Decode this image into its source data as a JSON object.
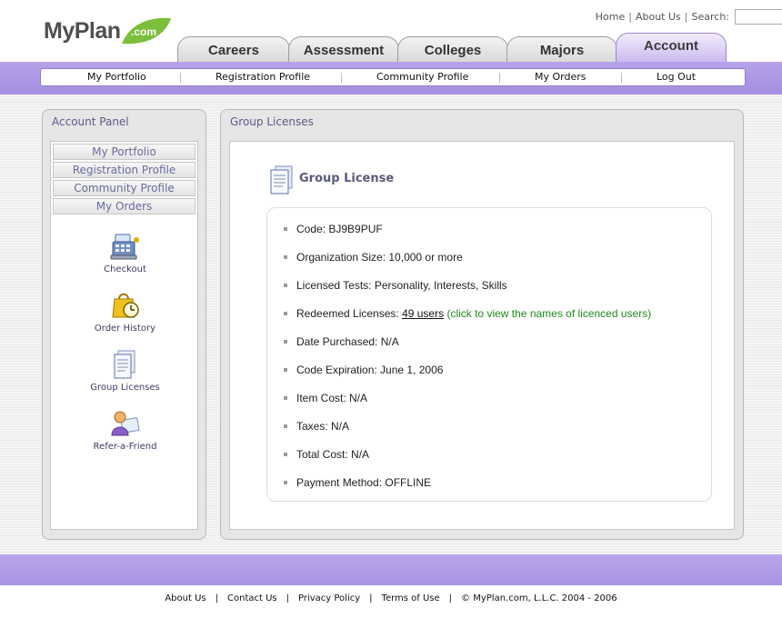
{
  "brand": {
    "name": "MyPlan",
    "suffix": ".com",
    "accent": "#7bbf3a"
  },
  "top_links": {
    "home": "Home",
    "about": "About Us",
    "search_label": "Search:"
  },
  "tabs": [
    {
      "label": "Careers"
    },
    {
      "label": "Assessment"
    },
    {
      "label": "Colleges"
    },
    {
      "label": "Majors"
    },
    {
      "label": "Account",
      "active": true
    }
  ],
  "subnav": [
    "My Portfolio",
    "Registration Profile",
    "Community Profile",
    "My Orders",
    "Log Out"
  ],
  "account_panel": {
    "title": "Account Panel",
    "menu": [
      "My Portfolio",
      "Registration Profile",
      "Community Profile",
      "My Orders"
    ],
    "icons": [
      {
        "label": "Checkout",
        "icon": "cash-register-icon"
      },
      {
        "label": "Order History",
        "icon": "clock-bag-icon"
      },
      {
        "label": "Group Licenses",
        "icon": "document-icon"
      },
      {
        "label": "Refer-a-Friend",
        "icon": "person-card-icon"
      }
    ]
  },
  "group_panel": {
    "title": "Group Licenses",
    "heading": "Group License",
    "details": {
      "code": "Code: BJ9B9PUF",
      "org_size": "Organization Size: 10,000 or more",
      "tests": "Licensed Tests: Personality, Interests, Skills",
      "redeemed_label": "Redeemed Licenses:",
      "redeemed_link": "49 users",
      "redeemed_hint": "(click to view the names of licenced users)",
      "date_purchased": "Date Purchased: N/A",
      "expiration": "Code Expiration: June 1, 2006",
      "item_cost": "Item Cost: N/A",
      "taxes": "Taxes: N/A",
      "total_cost": "Total Cost: N/A",
      "payment_method": "Payment Method: OFFLINE"
    }
  },
  "footer": {
    "about": "About Us",
    "contact": "Contact Us",
    "privacy": "Privacy Policy",
    "terms": "Terms of Use",
    "copyright": "© MyPlan.com, L.L.C. 2004 - 2006"
  },
  "colors": {
    "purple": "#a893e2",
    "panel_title": "#5a5a8a",
    "hint_green": "#1f8a1f"
  }
}
